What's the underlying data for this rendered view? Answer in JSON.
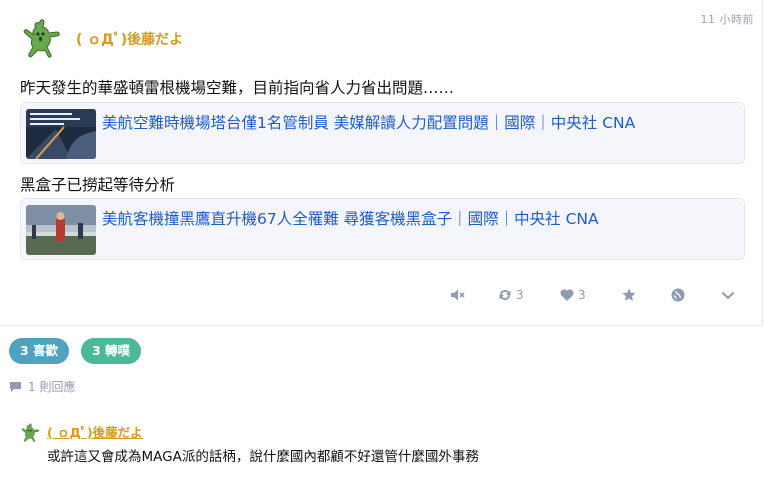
{
  "post": {
    "author_name": "( ｏДﾟ)後藤だよ",
    "time": "11 小時前",
    "text1": "昨天發生的華盛頓雷根機場空難，目前指向省人力省出問題……",
    "link1": {
      "title": "美航空難時機場塔台僅1名管制員 美媒解讀人力配置問題｜國際｜中央社 CNA"
    },
    "text2": "黑盒子已撈起等待分析",
    "link2": {
      "title": "美航客機撞黑鷹直升機67人全罹難 尋獲客機黑盒子｜國際｜中央社 CNA"
    }
  },
  "actions": {
    "mute_icon": "speaker-mute-icon",
    "boost_icon": "retweet-icon",
    "boost_count": "3",
    "like_icon": "heart-icon",
    "like_count": "3",
    "star_icon": "star-icon",
    "globe_icon": "globe-icon",
    "more_icon": "chevron-down-icon"
  },
  "stats": {
    "likes_pill": "3 喜歡",
    "boosts_pill": "3 轉噗",
    "likes_color": "#4fa3bf",
    "boosts_color": "#4cb89a",
    "reply_count": "1 則回應"
  },
  "reply": {
    "author_name": "( ｏДﾟ)後藤だよ",
    "text": "或許這又會成為MAGA派的話柄，說什麼國內都顧不好還管什麼國外事務"
  },
  "colors": {
    "author": "#d99a1b",
    "link": "#1f5bd1",
    "icon": "#8f9bb0"
  }
}
